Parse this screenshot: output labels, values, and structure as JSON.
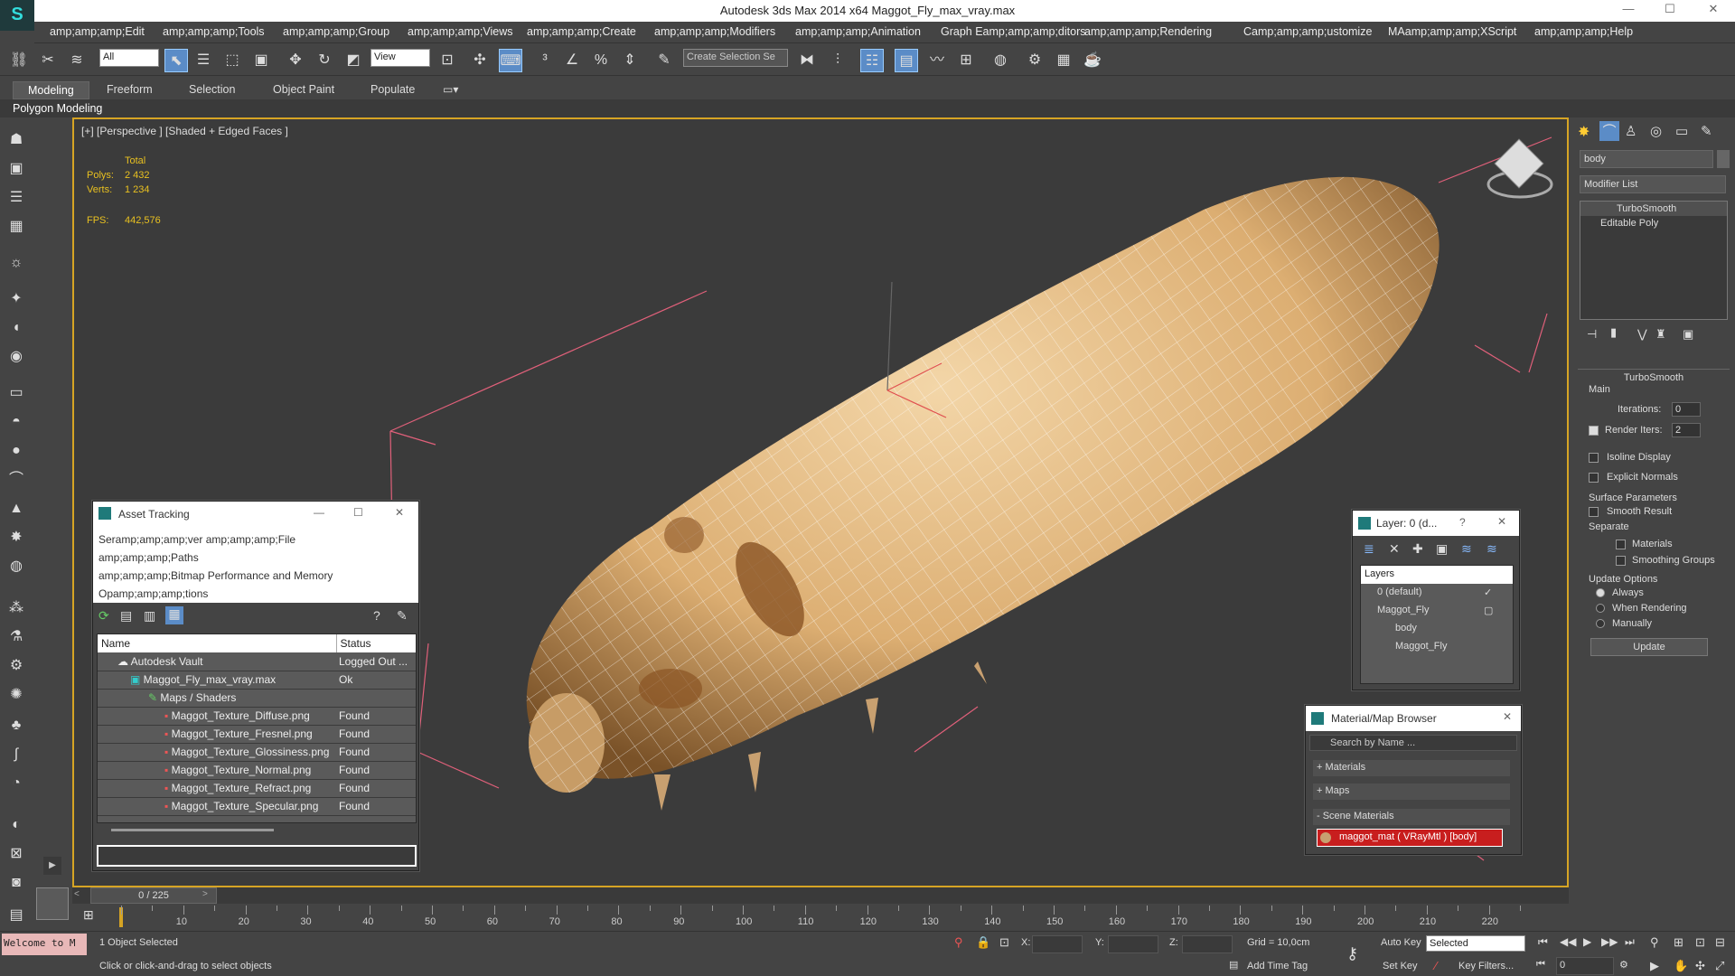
{
  "window": {
    "app_title": "Autodesk 3ds Max  2014 x64     Maggot_Fly_max_vray.max",
    "min": "—",
    "max": "☐",
    "close": "✕"
  },
  "menu": [
    "amp;amp;amp;Edit",
    "amp;amp;amp;Tools",
    "amp;amp;amp;Group",
    "amp;amp;amp;Views",
    "amp;amp;amp;Create",
    "amp;amp;amp;Modifiers",
    "amp;amp;amp;Animation",
    "Graph Eamp;amp;amp;ditors",
    "amp;amp;amp;Rendering",
    "Camp;amp;amp;ustomize",
    "MAamp;amp;amp;XScript",
    "amp;amp;amp;Help"
  ],
  "toolbar": {
    "filter": "All",
    "refcoord": "View",
    "selset": "Create Selection Se"
  },
  "ribbon": {
    "tabs": [
      "Modeling",
      "Freeform",
      "Selection",
      "Object Paint",
      "Populate"
    ],
    "sub": "Polygon Modeling"
  },
  "viewport": {
    "label": "[+] [Perspective ] [Shaded + Edged Faces ]",
    "stats_header": "Total",
    "polys_label": "Polys:",
    "polys": "2 432",
    "verts_label": "Verts:",
    "verts": "1 234",
    "fps_label": "FPS:",
    "fps": "442,576"
  },
  "asset_tracking": {
    "title": "Asset Tracking",
    "menu1": "Seramp;amp;amp;ver     amp;amp;amp;File",
    "menu2": "amp;amp;amp;Paths",
    "menu3": "amp;amp;amp;Bitmap Performance and Memory",
    "menu4": "Opamp;amp;amp;tions",
    "col_name": "Name",
    "col_status": "Status",
    "rows": [
      {
        "name": "Autodesk Vault",
        "status": "Logged Out ..."
      },
      {
        "name": "Maggot_Fly_max_vray.max",
        "status": "Ok"
      },
      {
        "name": "Maps / Shaders",
        "status": ""
      },
      {
        "name": "Maggot_Texture_Diffuse.png",
        "status": "Found"
      },
      {
        "name": "Maggot_Texture_Fresnel.png",
        "status": "Found"
      },
      {
        "name": "Maggot_Texture_Glossiness.png",
        "status": "Found"
      },
      {
        "name": "Maggot_Texture_Normal.png",
        "status": "Found"
      },
      {
        "name": "Maggot_Texture_Refract.png",
        "status": "Found"
      },
      {
        "name": "Maggot_Texture_Specular.png",
        "status": "Found"
      }
    ]
  },
  "layer_panel": {
    "title": "Layer: 0 (d...",
    "help": "?",
    "header": "Layers",
    "items": [
      "0 (default)",
      "Maggot_Fly",
      "body",
      "Maggot_Fly"
    ]
  },
  "material_browser": {
    "title": "Material/Map Browser",
    "search_placeholder": "Search by Name ...",
    "sections": [
      "+ Materials",
      "+ Maps",
      "- Scene Materials"
    ],
    "scene_material": "maggot_mat  ( VRayMtl ) [body]"
  },
  "command_panel": {
    "object_name": "body",
    "modifier_list": "Modifier List",
    "stack": [
      "TurboSmooth",
      "Editable Poly"
    ],
    "rollout": "TurboSmooth",
    "main": "Main",
    "iterations_label": "Iterations:",
    "iterations": "0",
    "render_iters_label": "Render Iters:",
    "render_iters": "2",
    "isoline": "Isoline Display",
    "explicit": "Explicit Normals",
    "surface": "Surface Parameters",
    "smooth_result": "Smooth Result",
    "separate": "Separate",
    "materials": "Materials",
    "smoothing_groups": "Smoothing Groups",
    "update_options": "Update Options",
    "always": "Always",
    "when_rendering": "When Rendering",
    "manually": "Manually",
    "update_btn": "Update"
  },
  "timeline": {
    "frame": "0 / 225",
    "ticks": [
      "10",
      "20",
      "30",
      "40",
      "50",
      "60",
      "70",
      "80",
      "90",
      "100",
      "110",
      "120",
      "130",
      "140",
      "150",
      "160",
      "170",
      "180",
      "190",
      "200",
      "210",
      "220"
    ]
  },
  "status": {
    "maxscript": "Welcome to M",
    "selected": "1 Object Selected",
    "prompt": "Click or click-and-drag to select objects",
    "x": "X:",
    "y": "Y:",
    "z": "Z:",
    "grid": "Grid = 10,0cm",
    "add_time_tag": "Add Time Tag",
    "auto_key": "Auto Key",
    "set_key": "Set Key",
    "key_mode": "Selected",
    "key_filters": "Key Filters...",
    "frame_field": "0"
  }
}
